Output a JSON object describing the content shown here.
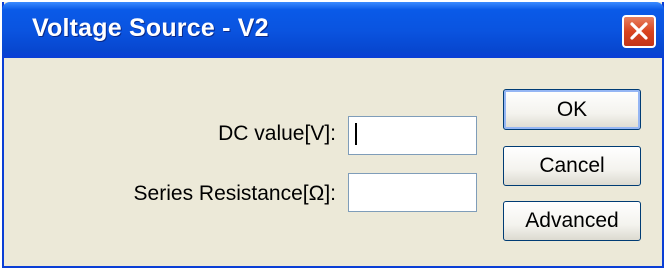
{
  "window": {
    "title": "Voltage Source - V2",
    "close_icon": "close-x-icon"
  },
  "form": {
    "dc_value_label": "DC value[V]:",
    "dc_value_value": "",
    "series_resistance_label": "Series Resistance[Ω]:",
    "series_resistance_value": ""
  },
  "buttons": {
    "ok": "OK",
    "cancel": "Cancel",
    "advanced": "Advanced"
  },
  "colors": {
    "titlebar": "#0a54e0",
    "close_button": "#d9441f",
    "dialog_bg": "#ece9d8"
  }
}
